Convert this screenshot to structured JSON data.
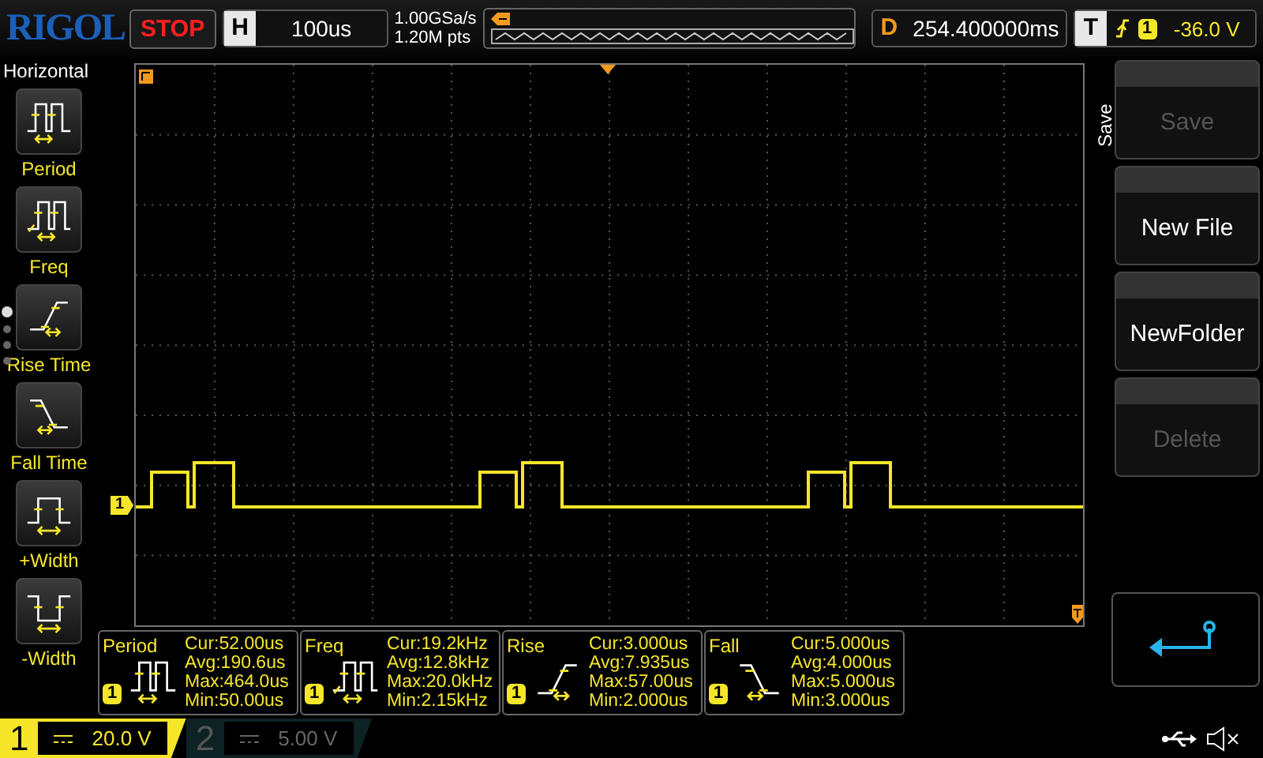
{
  "header": {
    "logo": "RIGOL",
    "run_state": "STOP",
    "timebase": {
      "label": "H",
      "value": "100us"
    },
    "sample_rate": "1.00GSa/s",
    "memory_depth": "1.20M pts",
    "delay": {
      "label": "D",
      "value": "254.400000ms"
    },
    "trigger": {
      "label": "T",
      "channel": "1",
      "level": "-36.0 V"
    }
  },
  "sidebar": {
    "title": "Horizontal",
    "page_dots": [
      {
        "selected": true
      },
      {
        "selected": false
      },
      {
        "selected": false
      },
      {
        "selected": false
      }
    ],
    "items": [
      {
        "kind": "period",
        "label": "Period"
      },
      {
        "kind": "freq",
        "label": "Freq"
      },
      {
        "kind": "rise",
        "label": "Rise Time"
      },
      {
        "kind": "fall",
        "label": "Fall Time"
      },
      {
        "kind": "pos_width",
        "label": "+Width"
      },
      {
        "kind": "neg_width",
        "label": "-Width"
      }
    ]
  },
  "grid": {
    "channel_marker": "1"
  },
  "measurements": [
    {
      "kind": "period",
      "label": "Period",
      "channel": "1",
      "cur": "Cur:52.00us",
      "avg": "Avg:190.6us",
      "max": "Max:464.0us",
      "min": "Min:50.00us"
    },
    {
      "kind": "freq",
      "label": "Freq",
      "channel": "1",
      "cur": "Cur:19.2kHz",
      "avg": "Avg:12.8kHz",
      "max": "Max:20.0kHz",
      "min": "Min:2.15kHz"
    },
    {
      "kind": "rise",
      "label": "Rise",
      "channel": "1",
      "cur": "Cur:3.000us",
      "avg": "Avg:7.935us",
      "max": "Max:57.00us",
      "min": "Min:2.000us"
    },
    {
      "kind": "fall",
      "label": "Fall",
      "channel": "1",
      "cur": "Cur:5.000us",
      "avg": "Avg:4.000us",
      "max": "Max:5.000us",
      "min": "Min:3.000us"
    }
  ],
  "menu": {
    "title": "Save",
    "buttons": [
      {
        "label": "Save",
        "disabled": true
      },
      {
        "label": "New File",
        "disabled": false
      },
      {
        "label": "NewFolder",
        "disabled": false
      },
      {
        "label": "Delete",
        "disabled": true
      }
    ]
  },
  "channels": [
    {
      "number": "1",
      "scale": "20.0 V",
      "active": true
    },
    {
      "number": "2",
      "scale": "5.00 V",
      "active": false
    }
  ]
}
